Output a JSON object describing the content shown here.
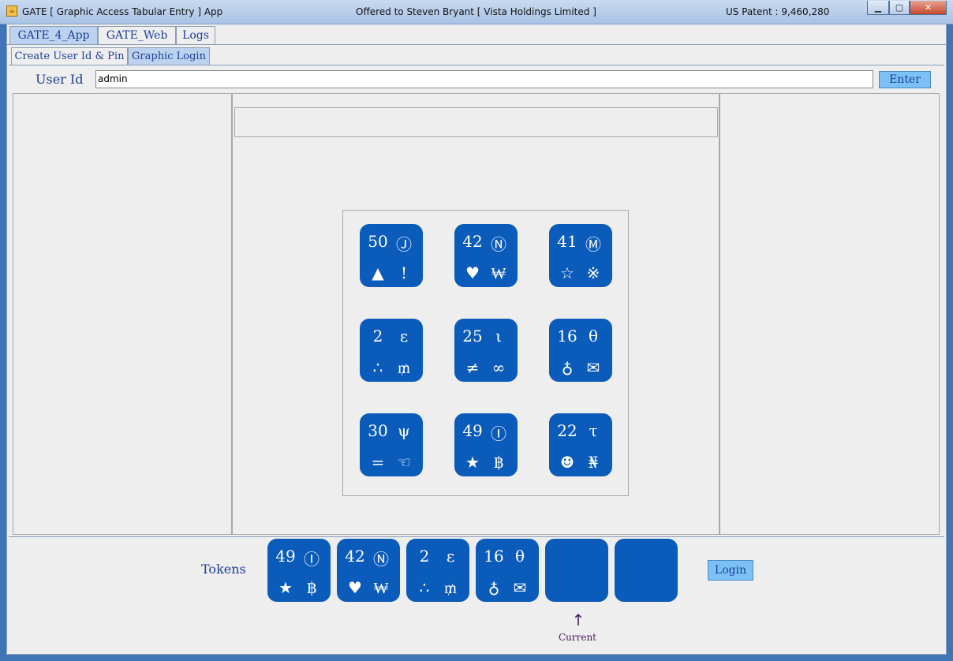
{
  "window": {
    "title": "GATE [ Graphic Access Tabular Entry ] App",
    "offered_to": "Offered to Steven Bryant [ Vista Holdings Limited ]",
    "patent": "US Patent : 9,460,280",
    "minimize": "▁",
    "maximize": "▢",
    "close": "✕"
  },
  "tabs": [
    {
      "label": "GATE_4_App",
      "selected": true
    },
    {
      "label": "GATE_Web",
      "selected": false
    },
    {
      "label": "Logs",
      "selected": false
    }
  ],
  "subtabs": [
    {
      "label": "Create User Id & Pin",
      "selected": false
    },
    {
      "label": "Graphic Login",
      "selected": true
    }
  ],
  "user": {
    "label": "User Id",
    "value": "admin",
    "enter_button": "Enter"
  },
  "message_box": "",
  "grid": [
    {
      "number": "50",
      "letter": "Ⓙ",
      "sym1": "▲",
      "sym2": "!"
    },
    {
      "number": "42",
      "letter": "Ⓝ",
      "sym1": "♥",
      "sym2": "₩"
    },
    {
      "number": "41",
      "letter": "Ⓜ",
      "sym1": "☆",
      "sym2": "※"
    },
    {
      "number": "2",
      "letter": "ε",
      "sym1": "∴",
      "sym2": "₥"
    },
    {
      "number": "25",
      "letter": "ι",
      "sym1": "≠",
      "sym2": "∞"
    },
    {
      "number": "16",
      "letter": "θ",
      "sym1": "♁",
      "sym2": "✉"
    },
    {
      "number": "30",
      "letter": "ψ",
      "sym1": "=",
      "sym2": "☜"
    },
    {
      "number": "49",
      "letter": "Ⓘ",
      "sym1": "★",
      "sym2": "฿"
    },
    {
      "number": "22",
      "letter": "τ",
      "sym1": "☻",
      "sym2": "₦"
    }
  ],
  "tokens": {
    "label": "Tokens",
    "items": [
      {
        "number": "49",
        "letter": "Ⓘ",
        "sym1": "★",
        "sym2": "฿"
      },
      {
        "number": "42",
        "letter": "Ⓝ",
        "sym1": "♥",
        "sym2": "₩"
      },
      {
        "number": "2",
        "letter": "ε",
        "sym1": "∴",
        "sym2": "₥"
      },
      {
        "number": "16",
        "letter": "θ",
        "sym1": "♁",
        "sym2": "✉"
      },
      {
        "number": "",
        "letter": "",
        "sym1": "",
        "sym2": ""
      },
      {
        "number": "",
        "letter": "",
        "sym1": "",
        "sym2": ""
      }
    ],
    "current_arrow": "↑",
    "current_label": "Current",
    "current_index": 4
  },
  "login_button": "Login",
  "colors": {
    "tile": "#0b5bbb",
    "button": "#7cc1f5",
    "label_text": "#1d3f9a",
    "current_text": "#4a1c5e"
  }
}
